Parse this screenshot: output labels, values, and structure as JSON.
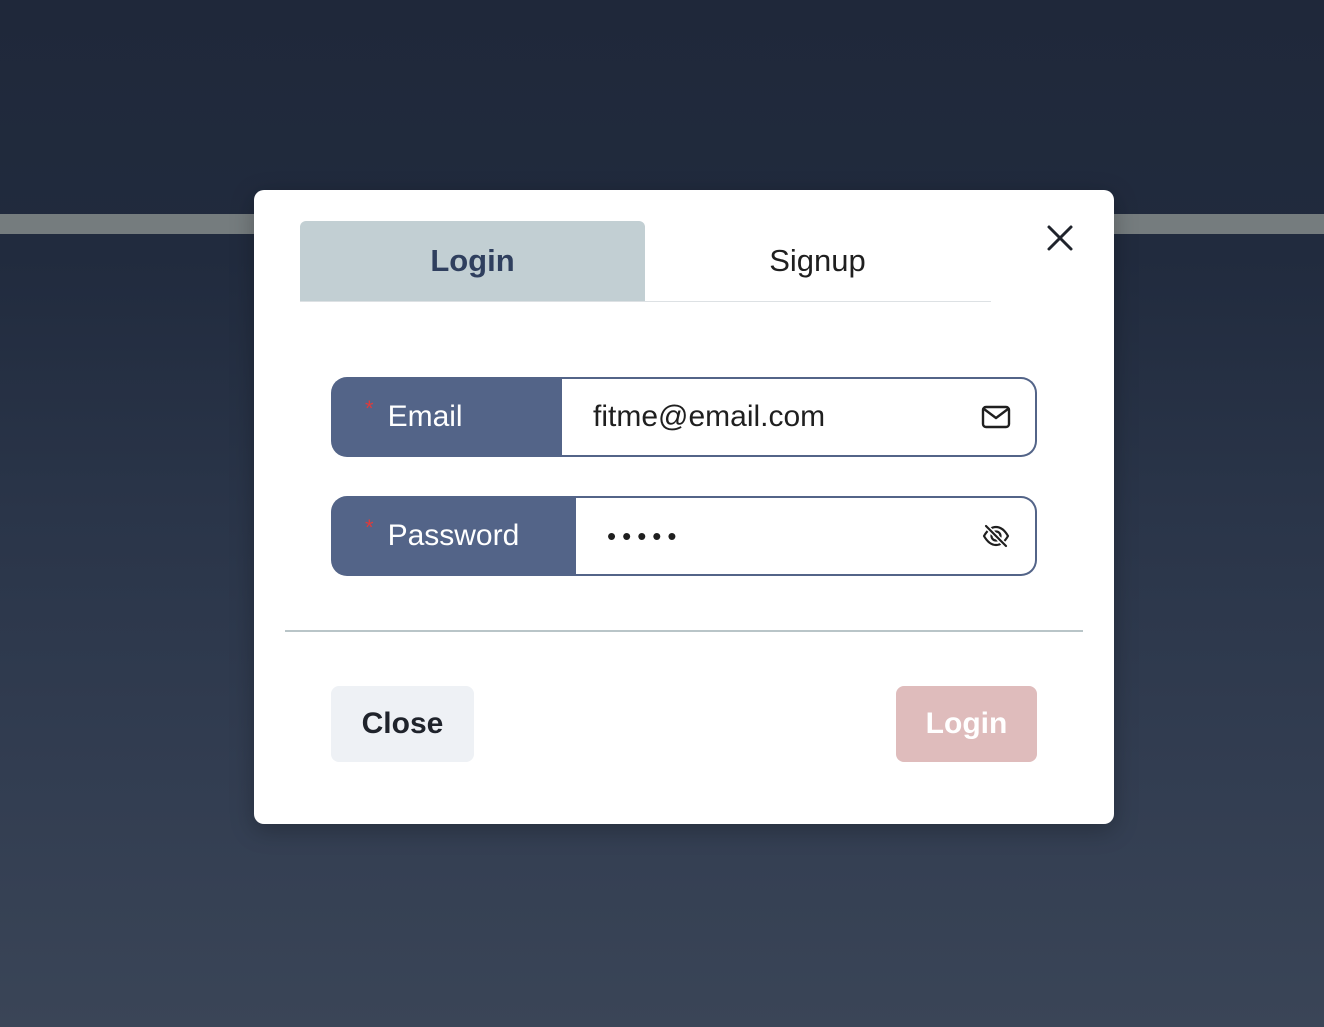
{
  "modal": {
    "tabs": [
      {
        "label": "Login",
        "active": true
      },
      {
        "label": "Signup",
        "active": false
      }
    ],
    "close_icon": "close-icon"
  },
  "form": {
    "email": {
      "label": "Email",
      "required_marker": "*",
      "value": "fitme@email.com",
      "icon": "mail-icon"
    },
    "password": {
      "label": "Password",
      "required_marker": "*",
      "value": "•••••",
      "icon": "eye-off-icon"
    }
  },
  "footer": {
    "close_label": "Close",
    "login_label": "Login"
  },
  "colors": {
    "label_bg": "#536488",
    "active_tab_bg": "#c2cfd3",
    "required": "#dc3c3c",
    "login_button_bg": "#dfbcbc",
    "close_button_bg": "#eef1f5"
  }
}
